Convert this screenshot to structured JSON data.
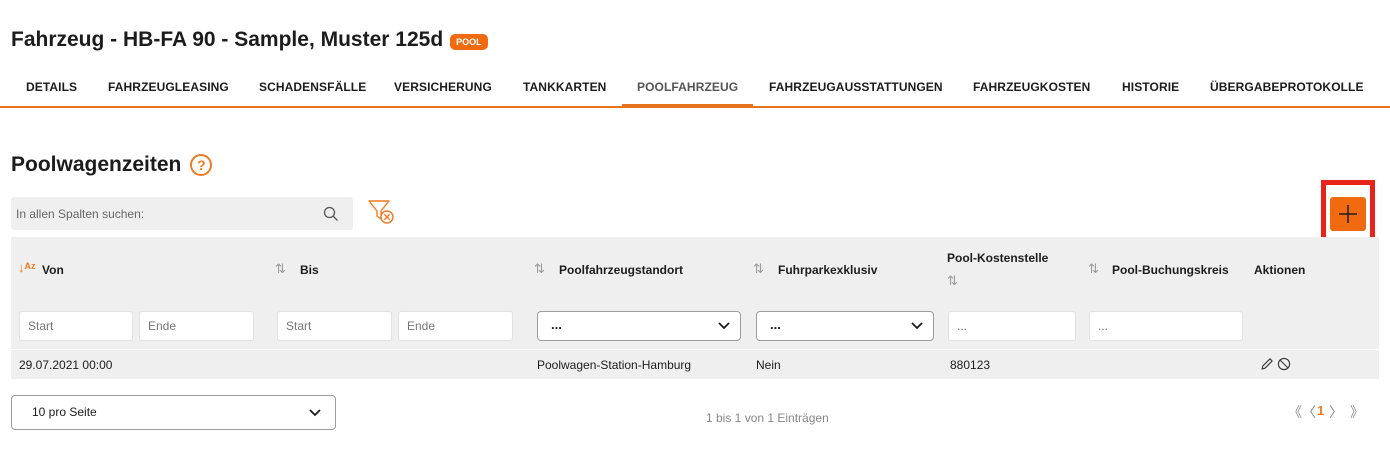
{
  "header": {
    "title": "Fahrzeug - HB-FA 90 - Sample, Muster 125d",
    "badge": "POOL"
  },
  "tabs": [
    {
      "label": "DETAILS"
    },
    {
      "label": "FAHRZEUGLEASING"
    },
    {
      "label": "SCHADENSFÄLLE"
    },
    {
      "label": "VERSICHERUNG"
    },
    {
      "label": "TANKKARTEN"
    },
    {
      "label": "POOLFAHRZEUG",
      "active": true
    },
    {
      "label": "FAHRZEUGAUSSTATTUNGEN"
    },
    {
      "label": "FAHRZEUGKOSTEN"
    },
    {
      "label": "HISTORIE"
    },
    {
      "label": "ÜBERGABEPROTOKOLLE"
    }
  ],
  "section": {
    "title": "Poolwagenzeiten",
    "help_glyph": "?"
  },
  "search": {
    "placeholder": "In allen Spalten suchen:"
  },
  "add_button": {
    "glyph": "+"
  },
  "table": {
    "columns": [
      {
        "label": "Von",
        "sort": "ascending"
      },
      {
        "label": "Bis",
        "sort": "none"
      },
      {
        "label": "Poolfahrzeugstandort",
        "sort": "none"
      },
      {
        "label": "Fuhrparkexklusiv",
        "sort": "none"
      },
      {
        "label": "Pool-Kostenstelle",
        "sort": "none"
      },
      {
        "label": "Pool-Buchungskreis",
        "sort": "none"
      },
      {
        "label": "Aktionen"
      }
    ],
    "sort_glyph": "⇅",
    "sort_asc_glyph": "↓ᴬᶻ",
    "filters": {
      "von_start": "Start",
      "von_ende": "Ende",
      "bis_start": "Start",
      "bis_ende": "Ende",
      "standort_select": "...",
      "exklusiv_select": "...",
      "kostenstelle": "...",
      "buchungskreis": "..."
    },
    "rows": [
      {
        "von": "29.07.2021 00:00",
        "bis": "",
        "standort": "Poolwagen-Station-Hamburg",
        "exklusiv": "Nein",
        "kostenstelle": "880123",
        "buchungskreis": ""
      }
    ]
  },
  "footer": {
    "page_size": "10 pro Seite",
    "entries_info": "1 bis 1 von 1 Einträgen",
    "pager": {
      "first": "《",
      "prev": "〈",
      "current": "1",
      "next": "〉",
      "last": "》"
    }
  },
  "colors": {
    "accent": "#f26a10",
    "highlight": "#e8231c"
  }
}
